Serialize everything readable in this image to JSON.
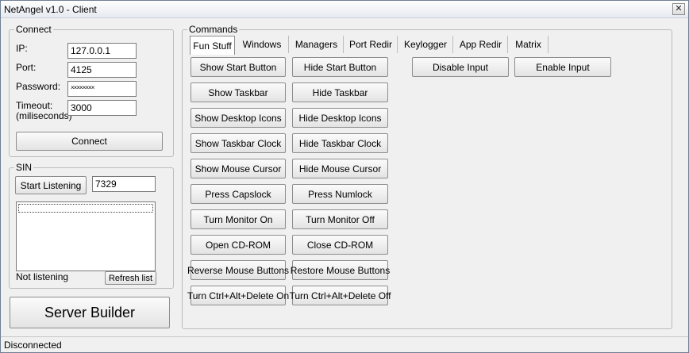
{
  "window": {
    "title": "NetAngel v1.0 - Client",
    "close_glyph": "✕"
  },
  "connect": {
    "legend": "Connect",
    "ip_label": "IP:",
    "ip_value": "127.0.0.1",
    "port_label": "Port:",
    "port_value": "4125",
    "password_label": "Password:",
    "password_value": "××××××××",
    "timeout_label_1": "Timeout:",
    "timeout_label_2": "(miliseconds)",
    "timeout_value": "3000",
    "connect_button": "Connect"
  },
  "sin": {
    "legend": "SIN",
    "start_button": "Start Listening",
    "port_value": "7329",
    "status": "Not listening",
    "refresh_button": "Refresh list"
  },
  "server_builder_button": "Server Builder",
  "commands": {
    "legend": "Commands",
    "tabs": [
      "Fun Stuff",
      "Windows",
      "Managers",
      "Port Redir",
      "Keylogger",
      "App Redir",
      "Matrix"
    ],
    "active_tab": "Fun Stuff",
    "fun_stuff": {
      "left": [
        "Show Start Button",
        "Show Taskbar",
        "Show Desktop Icons",
        "Show Taskbar Clock",
        "Show Mouse Cursor",
        "Press Capslock",
        "Turn Monitor On",
        "Open CD-ROM",
        "Reverse Mouse Buttons",
        "Turn Ctrl+Alt+Delete On"
      ],
      "right": [
        "Hide Start Button",
        "Hide Taskbar",
        "Hide Desktop Icons",
        "Hide Taskbar Clock",
        "Hide Mouse Cursor",
        "Press Numlock",
        "Turn Monitor Off",
        "Close CD-ROM",
        "Restore Mouse Buttons",
        "Turn Ctrl+Alt+Delete Off"
      ],
      "disable_input": "Disable Input",
      "enable_input": "Enable Input"
    }
  },
  "statusbar": {
    "text": "Disconnected"
  }
}
